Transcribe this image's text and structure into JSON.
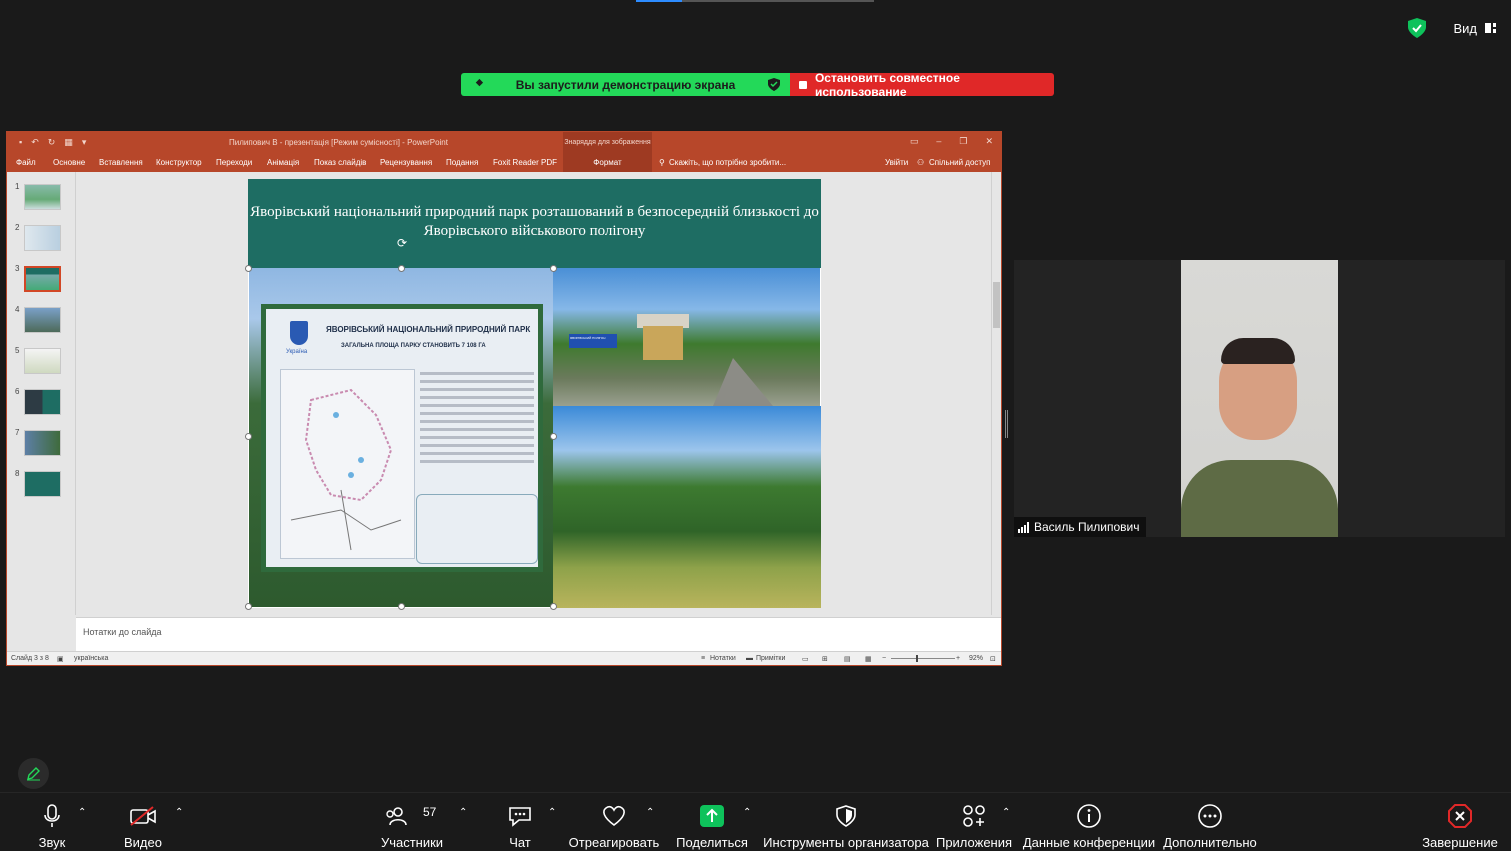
{
  "share_bar": {
    "status": "Вы запустили демонстрацию экрана",
    "stop": "Остановить совместное использование"
  },
  "view": {
    "label": "Вид"
  },
  "ppt": {
    "title": "Пилипович В - презентація [Режим сумісності] - PowerPoint",
    "context_group": "Знаряддя для зображення",
    "tabs": [
      "Файл",
      "Основне",
      "Вставлення",
      "Конструктор",
      "Переходи",
      "Анімація",
      "Показ слайдів",
      "Рецензування",
      "Подання",
      "Foxit Reader PDF"
    ],
    "format_tab": "Формат",
    "tell_me": "Скажіть, що потрібно зробити...",
    "signin": "Увійти",
    "share": "Спільний доступ",
    "thumb_numbers": [
      "1",
      "2",
      "3",
      "4",
      "5",
      "6",
      "7",
      "8"
    ],
    "slide": {
      "title": "Яворівський національний природний парк розташований в безпосередній близькості до Яворівського військового полігону",
      "sign_title": "ЯВОРІВСЬКИЙ НАЦІОНАЛЬНИЙ ПРИРОДНИЙ ПАРК",
      "sign_subtitle": "ЗАГАЛЬНА ПЛОЩА ПАРКУ СТАНОВИТЬ 7 108 ГА",
      "sign_country": "Україна",
      "road_sign": "ЯВОРІВСЬКИЙ ПОЛІГОН"
    },
    "notes_placeholder": "Нотатки до слайда",
    "status": {
      "slide": "Слайд 3 з 8",
      "language": "українська",
      "notes": "Нотатки",
      "comments": "Примітки",
      "zoom": "92%"
    }
  },
  "participant": {
    "name": "Василь Пилипович"
  },
  "toolbar": {
    "audio": "Звук",
    "video": "Видео",
    "participants": "Участники",
    "participants_count": "57",
    "chat": "Чат",
    "react": "Отреагировать",
    "share": "Поделиться",
    "host_tools": "Инструменты организатора",
    "apps": "Приложения",
    "meeting_info": "Данные конференции",
    "more": "Дополнительно",
    "end": "Завершение"
  },
  "colors": {
    "share_green": "#23d959",
    "stop_red": "#e02828",
    "ppt_accent": "#b7472a",
    "slide_header": "#1e6d63",
    "share_icon_green": "#0ec25b",
    "end_red": "#e02828"
  }
}
